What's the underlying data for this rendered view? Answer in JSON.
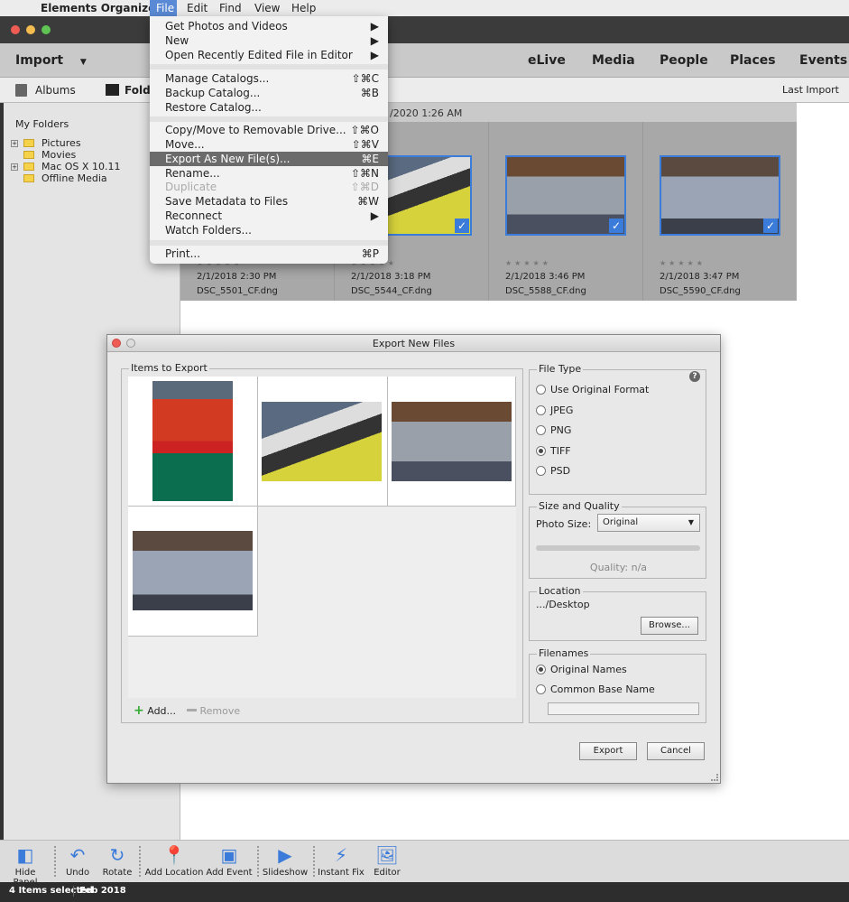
{
  "menubar": {
    "app": "Elements Organizer",
    "items": [
      "File",
      "Edit",
      "Find",
      "View",
      "Help"
    ]
  },
  "header": {
    "import": "Import",
    "tabs": [
      "eLive",
      "Media",
      "People",
      "Places",
      "Events"
    ]
  },
  "subbar": {
    "albums": "Albums",
    "folders": "Folders",
    "last_import": "Last Import"
  },
  "sidebar": {
    "title": "My Folders",
    "items": [
      "Pictures",
      "Movies",
      "Mac OS X 10.11",
      "Offline Media"
    ]
  },
  "grid": {
    "date_header": "/2020 1:26 AM",
    "items": [
      {
        "date": "2/1/2018 2:30 PM",
        "name": "DSC_5501_CF.dng"
      },
      {
        "date": "2/1/2018 3:18 PM",
        "name": "DSC_5544_CF.dng"
      },
      {
        "date": "2/1/2018 3:46 PM",
        "name": "DSC_5588_CF.dng"
      },
      {
        "date": "2/1/2018 3:47 PM",
        "name": "DSC_5590_CF.dng"
      }
    ],
    "stars": "★★★★★",
    "check": "✓"
  },
  "file_menu": {
    "items": [
      {
        "label": "Get Photos and Videos",
        "shortcut": "▶"
      },
      {
        "label": "New",
        "shortcut": "▶"
      },
      {
        "label": "Open Recently Edited File in Editor",
        "shortcut": "▶"
      },
      {
        "label": "Manage Catalogs...",
        "shortcut": "⇧⌘C"
      },
      {
        "label": "Backup Catalog...",
        "shortcut": "⌘B"
      },
      {
        "label": "Restore Catalog...",
        "shortcut": ""
      },
      {
        "label": "Copy/Move to Removable Drive...",
        "shortcut": "⇧⌘O"
      },
      {
        "label": "Move...",
        "shortcut": "⇧⌘V"
      },
      {
        "label": "Export As New File(s)...",
        "shortcut": "⌘E"
      },
      {
        "label": "Rename...",
        "shortcut": "⇧⌘N"
      },
      {
        "label": "Duplicate",
        "shortcut": "⇧⌘D"
      },
      {
        "label": "Save Metadata to Files",
        "shortcut": "⌘W"
      },
      {
        "label": "Reconnect",
        "shortcut": "▶"
      },
      {
        "label": "Watch Folders...",
        "shortcut": ""
      },
      {
        "label": "Print...",
        "shortcut": "⌘P"
      }
    ]
  },
  "dialog": {
    "title": "Export New Files",
    "items_label": "Items to Export",
    "add": "Add...",
    "remove": "Remove",
    "file_type": {
      "label": "File Type",
      "options": [
        "Use Original Format",
        "JPEG",
        "PNG",
        "TIFF",
        "PSD"
      ],
      "selected": "TIFF",
      "help": "?"
    },
    "size": {
      "label": "Size and Quality",
      "photo_size_label": "Photo Size:",
      "photo_size": "Original",
      "quality": "Quality: n/a"
    },
    "location": {
      "label": "Location",
      "path": ".../Desktop",
      "browse": "Browse..."
    },
    "filenames": {
      "label": "Filenames",
      "options": [
        "Original Names",
        "Common Base Name"
      ],
      "selected": "Original Names",
      "base_name": ""
    },
    "export": "Export",
    "cancel": "Cancel"
  },
  "toolbar": [
    "Hide Panel",
    "Undo",
    "Rotate",
    "Add Location",
    "Add Event",
    "Slideshow",
    "Instant Fix",
    "Editor"
  ],
  "status": {
    "selected": "4 Items selected",
    "date": "Feb 2018"
  }
}
